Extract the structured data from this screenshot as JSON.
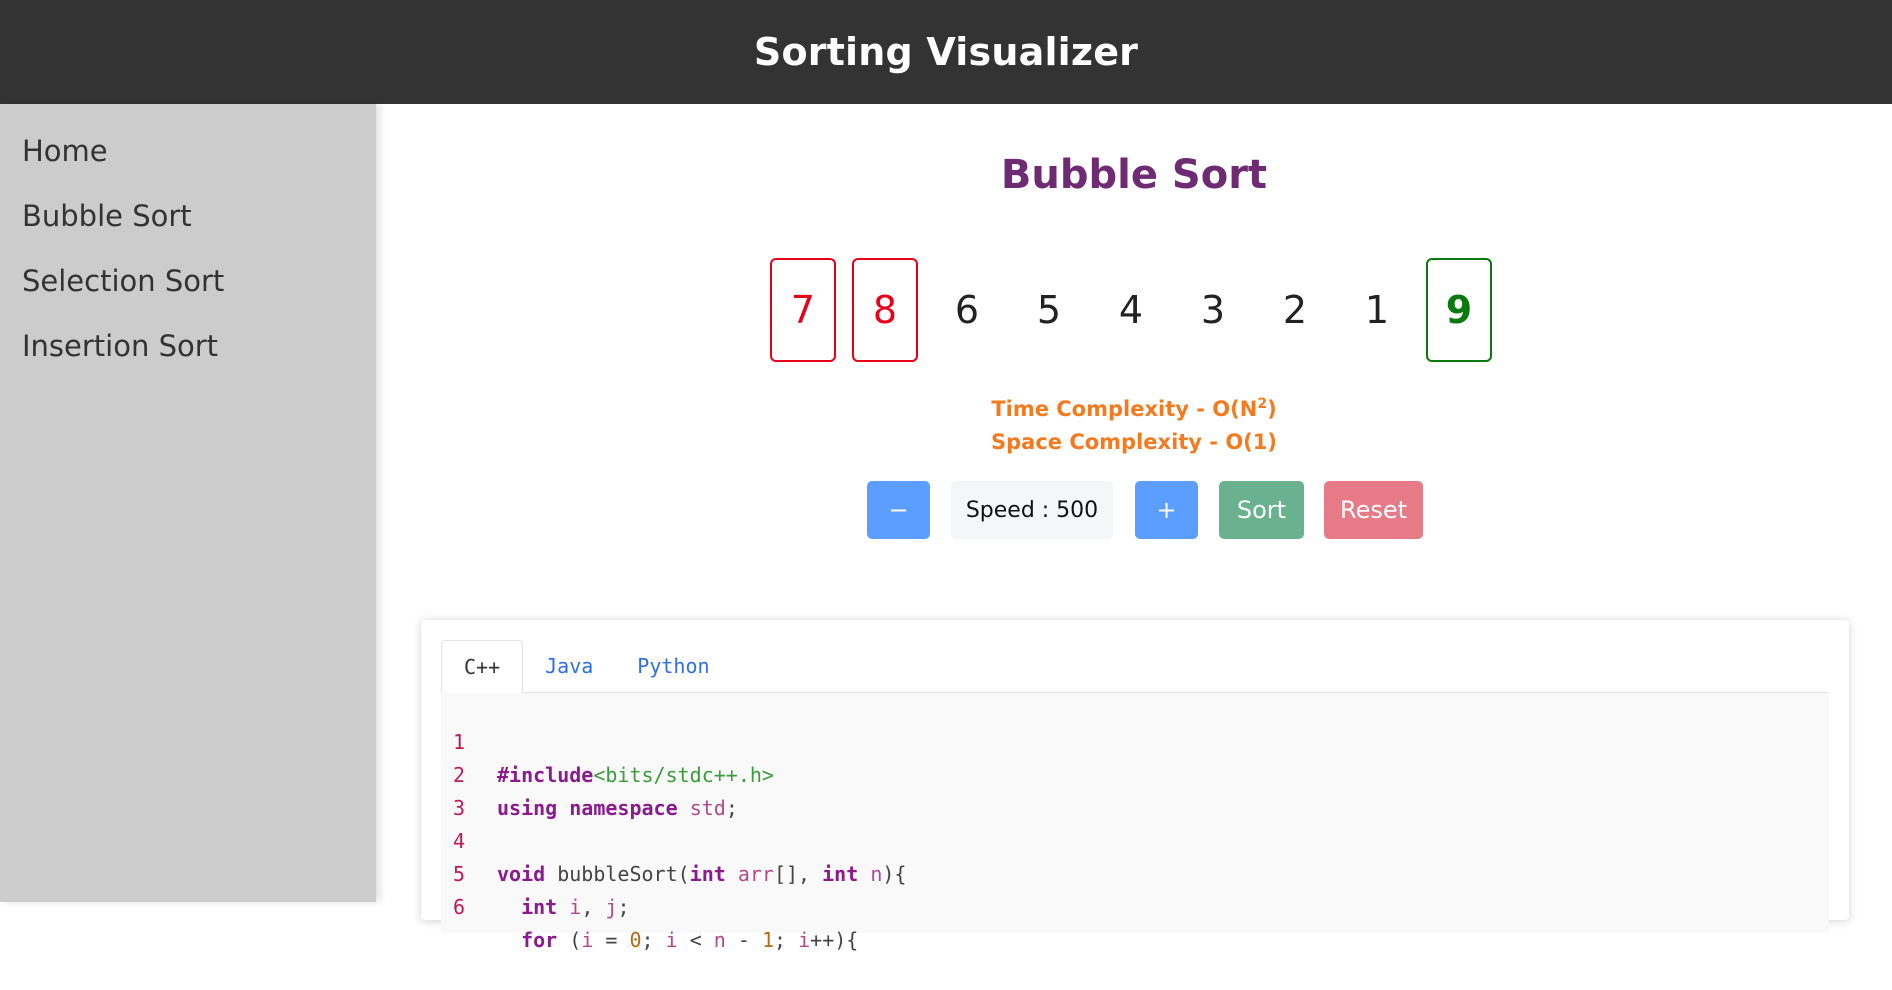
{
  "header": {
    "title": "Sorting Visualizer"
  },
  "sidebar": {
    "items": [
      {
        "label": "Home"
      },
      {
        "label": "Bubble Sort"
      },
      {
        "label": "Selection Sort"
      },
      {
        "label": "Insertion Sort"
      }
    ]
  },
  "main": {
    "title": "Bubble Sort",
    "array": [
      {
        "value": "7",
        "state": "comparing"
      },
      {
        "value": "8",
        "state": "comparing"
      },
      {
        "value": "6",
        "state": "default"
      },
      {
        "value": "5",
        "state": "default"
      },
      {
        "value": "4",
        "state": "default"
      },
      {
        "value": "3",
        "state": "default"
      },
      {
        "value": "2",
        "state": "default"
      },
      {
        "value": "1",
        "state": "default"
      },
      {
        "value": "9",
        "state": "sorted"
      }
    ],
    "time_complexity_prefix": "Time Complexity - O(N",
    "time_complexity_exp": "2",
    "time_complexity_suffix": ")",
    "space_complexity": "Space Complexity - O(1)",
    "controls": {
      "decrease_label": "−",
      "speed_label": "Speed : 500",
      "increase_label": "+",
      "sort_label": "Sort",
      "reset_label": "Reset"
    },
    "colors": {
      "comparing": "#e8001a",
      "sorted": "#0a7a10",
      "title": "#6e2a72",
      "complexity": "#f47a1f"
    }
  },
  "code": {
    "tabs": [
      {
        "label": "C++",
        "active": true
      },
      {
        "label": "Java",
        "active": false
      },
      {
        "label": "Python",
        "active": false
      }
    ],
    "lines": [
      {
        "num": "1",
        "text": "#include<bits/stdc++.h>"
      },
      {
        "num": "2",
        "text": "using namespace std;"
      },
      {
        "num": "3",
        "text": ""
      },
      {
        "num": "4",
        "text": "void bubbleSort(int arr[], int n){"
      },
      {
        "num": "5",
        "text": "  int i, j;"
      },
      {
        "num": "6",
        "text": "  for (i = 0; i < n - 1; i++){"
      }
    ]
  }
}
